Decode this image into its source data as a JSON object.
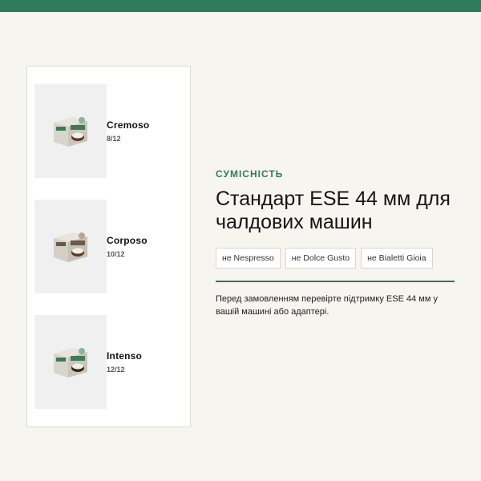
{
  "colors": {
    "accent": "#2f7a5a",
    "background": "#f6f5ef",
    "panel": "#ffffff"
  },
  "products": [
    {
      "name": "Cremoso",
      "count": "8/12",
      "icon": "capsule-box-icon"
    },
    {
      "name": "Corposo",
      "count": "10/12",
      "icon": "capsule-box-icon"
    },
    {
      "name": "Intenso",
      "count": "12/12",
      "icon": "capsule-box-icon"
    }
  ],
  "compatibility": {
    "eyebrow": "СУМІСНІСТЬ",
    "headline": "Стандарт ESE 44 мм для чалдових машин",
    "tags": [
      "не Nespresso",
      "не Dolce Gusto",
      "не Bialetti Gioia"
    ],
    "note": "Перед замовленням перевірте підтримку ESE 44 мм у вашій машині або адаптері."
  }
}
